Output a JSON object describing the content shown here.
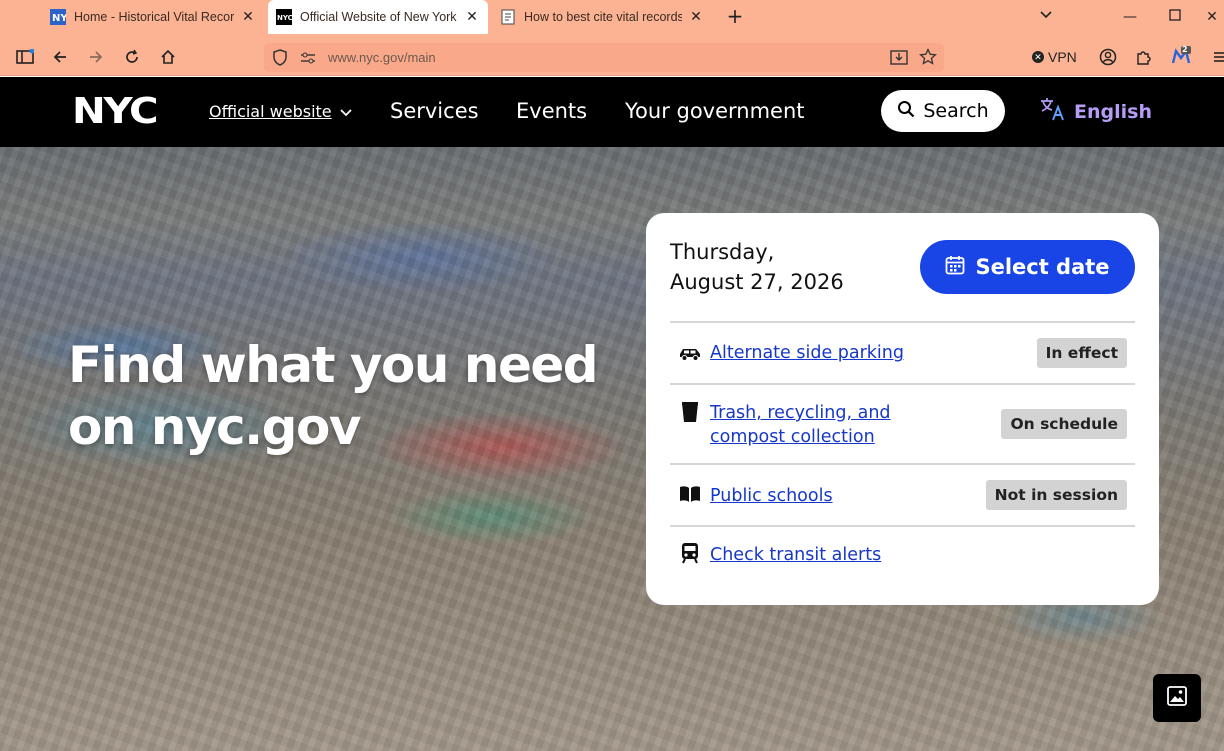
{
  "browser": {
    "tabs": [
      {
        "title": "Home - Historical Vital Records"
      },
      {
        "title": "Official Website of New York C"
      },
      {
        "title": "How to best cite vital records or"
      }
    ],
    "url": "www.nyc.gov/main",
    "vpn_label": "VPN",
    "extension_badge": "2"
  },
  "header": {
    "logo": "NYC",
    "official": "Official website",
    "nav": [
      "Services",
      "Events",
      "Your government"
    ],
    "search_label": "Search",
    "language": "English"
  },
  "hero": {
    "headline_line1": "Find what you need",
    "headline_line2": "on nyc.gov"
  },
  "card": {
    "date_line1": "Thursday,",
    "date_line2": "August 27, 2026",
    "select_date_label": "Select date",
    "items": [
      {
        "link_line1": "Alternate side parking",
        "link_line2": "",
        "status": "In effect",
        "icon": "car-icon"
      },
      {
        "link_line1": "Trash, recycling, and",
        "link_line2": "compost collection",
        "status": "On schedule",
        "icon": "trash-icon"
      },
      {
        "link_line1": "Public schools",
        "link_line2": "",
        "status": "Not in session",
        "icon": "book-icon"
      },
      {
        "link_line1": "Check transit alerts",
        "link_line2": "",
        "status": "",
        "icon": "train-icon"
      }
    ]
  },
  "colors": {
    "browser_chrome": "#fbb393",
    "header_bg": "#000000",
    "accent_blue": "#1a45e6",
    "link_blue": "#1637c9",
    "language_purple": "#b59cf5"
  }
}
